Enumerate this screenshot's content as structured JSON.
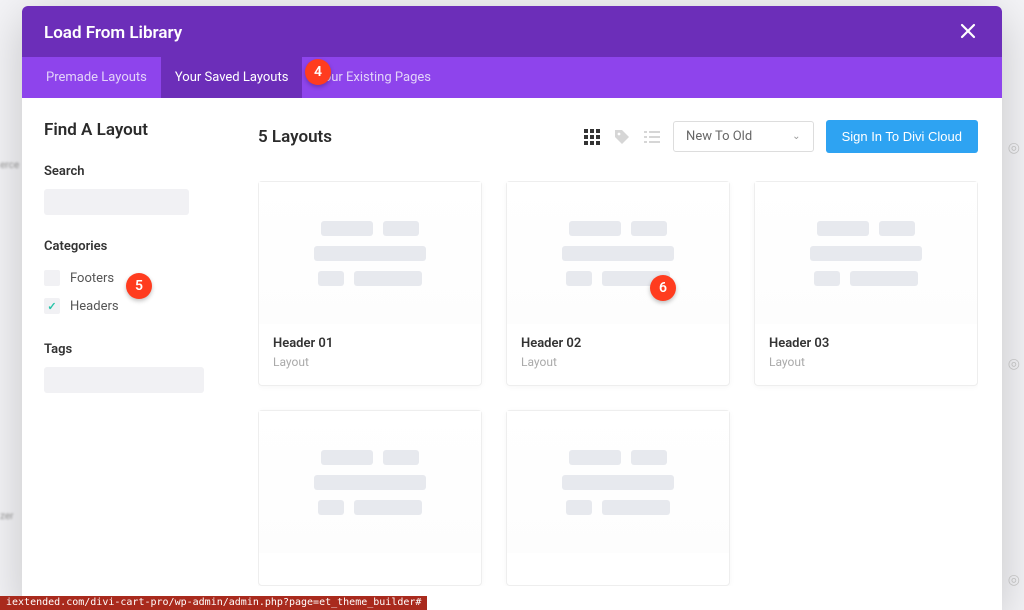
{
  "modal": {
    "title": "Load From Library",
    "tabs": [
      "Premade Layouts",
      "Your Saved Layouts",
      "Your Existing Pages"
    ],
    "active_tab_index": 1,
    "close_icon": "close-icon"
  },
  "sidebar": {
    "title": "Find A Layout",
    "search_label": "Search",
    "search_value": "",
    "categories_label": "Categories",
    "categories": [
      {
        "label": "Footers",
        "checked": false
      },
      {
        "label": "Headers",
        "checked": true
      }
    ],
    "tags_label": "Tags"
  },
  "main": {
    "count_title": "5 Layouts",
    "sort_label": "New To Old",
    "signin_label": "Sign In To Divi Cloud",
    "cards": [
      {
        "title": "Header 01",
        "sub": "Layout"
      },
      {
        "title": "Header 02",
        "sub": "Layout"
      },
      {
        "title": "Header 03",
        "sub": "Layout"
      },
      {
        "title": "",
        "sub": ""
      },
      {
        "title": "",
        "sub": ""
      }
    ]
  },
  "badges": {
    "4": "4",
    "5": "5",
    "6": "6"
  },
  "statusbar": "iextended.com/divi-cart-pro/wp-admin/admin.php?page=et_theme_builder#",
  "backdrop": {
    "left_labels": [
      "erce",
      "zer"
    ]
  }
}
